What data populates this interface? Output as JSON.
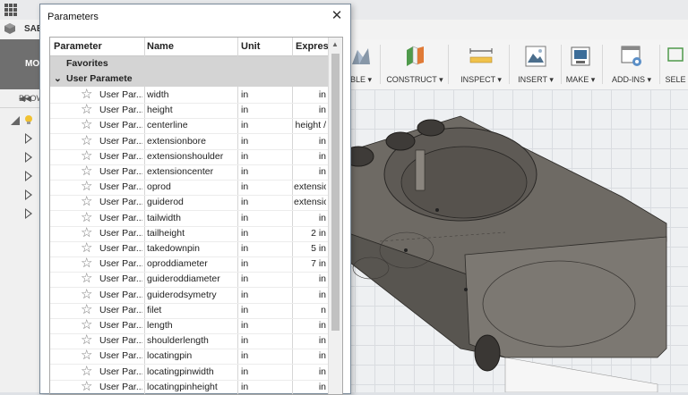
{
  "app": {
    "tab_label": "SAE",
    "mode_label": "MO",
    "browser_label": "BROW",
    "ribbon": [
      {
        "label": "BLE ▾",
        "icon": "form-icon"
      },
      {
        "label": "CONSTRUCT ▾",
        "icon": "construct-plane-icon"
      },
      {
        "label": "INSPECT ▾",
        "icon": "measure-icon"
      },
      {
        "label": "INSERT ▾",
        "icon": "insert-image-icon"
      },
      {
        "label": "MAKE ▾",
        "icon": "3d-print-icon"
      },
      {
        "label": "ADD-INS ▾",
        "icon": "addins-icon"
      },
      {
        "label": "SELE",
        "icon": "select-icon"
      }
    ]
  },
  "dialog": {
    "title": "Parameters",
    "columns": [
      "Parameter",
      "Name",
      "Unit",
      "Expres"
    ],
    "groups": [
      {
        "label": "Favorites"
      },
      {
        "label": "User Paramete"
      }
    ],
    "row_param_label": "User Par...",
    "rows": [
      {
        "name": "width",
        "unit": "in",
        "expr": "in"
      },
      {
        "name": "height",
        "unit": "in",
        "expr": "in"
      },
      {
        "name": "centerline",
        "unit": "in",
        "expr": "height /"
      },
      {
        "name": "extensionbore",
        "unit": "in",
        "expr": "in"
      },
      {
        "name": "extensionshoulder",
        "unit": "in",
        "expr": "in"
      },
      {
        "name": "extensioncenter",
        "unit": "in",
        "expr": "in"
      },
      {
        "name": "oprod",
        "unit": "in",
        "expr": "extensio"
      },
      {
        "name": "guiderod",
        "unit": "in",
        "expr": "extensio"
      },
      {
        "name": "tailwidth",
        "unit": "in",
        "expr": "in"
      },
      {
        "name": "tailheight",
        "unit": "in",
        "expr": "2 in"
      },
      {
        "name": "takedownpin",
        "unit": "in",
        "expr": "5 in"
      },
      {
        "name": "oproddiameter",
        "unit": "in",
        "expr": "7 in"
      },
      {
        "name": "guideroddiameter",
        "unit": "in",
        "expr": "in"
      },
      {
        "name": "guiderodsymetry",
        "unit": "in",
        "expr": "in"
      },
      {
        "name": "filet",
        "unit": "in",
        "expr": "n"
      },
      {
        "name": "length",
        "unit": "in",
        "expr": "in"
      },
      {
        "name": "shoulderlength",
        "unit": "in",
        "expr": "in"
      },
      {
        "name": "locatingpin",
        "unit": "in",
        "expr": "in"
      },
      {
        "name": "locatingpinwidth",
        "unit": "in",
        "expr": "in"
      },
      {
        "name": "locatingpinheight",
        "unit": "in",
        "expr": "in"
      }
    ]
  }
}
